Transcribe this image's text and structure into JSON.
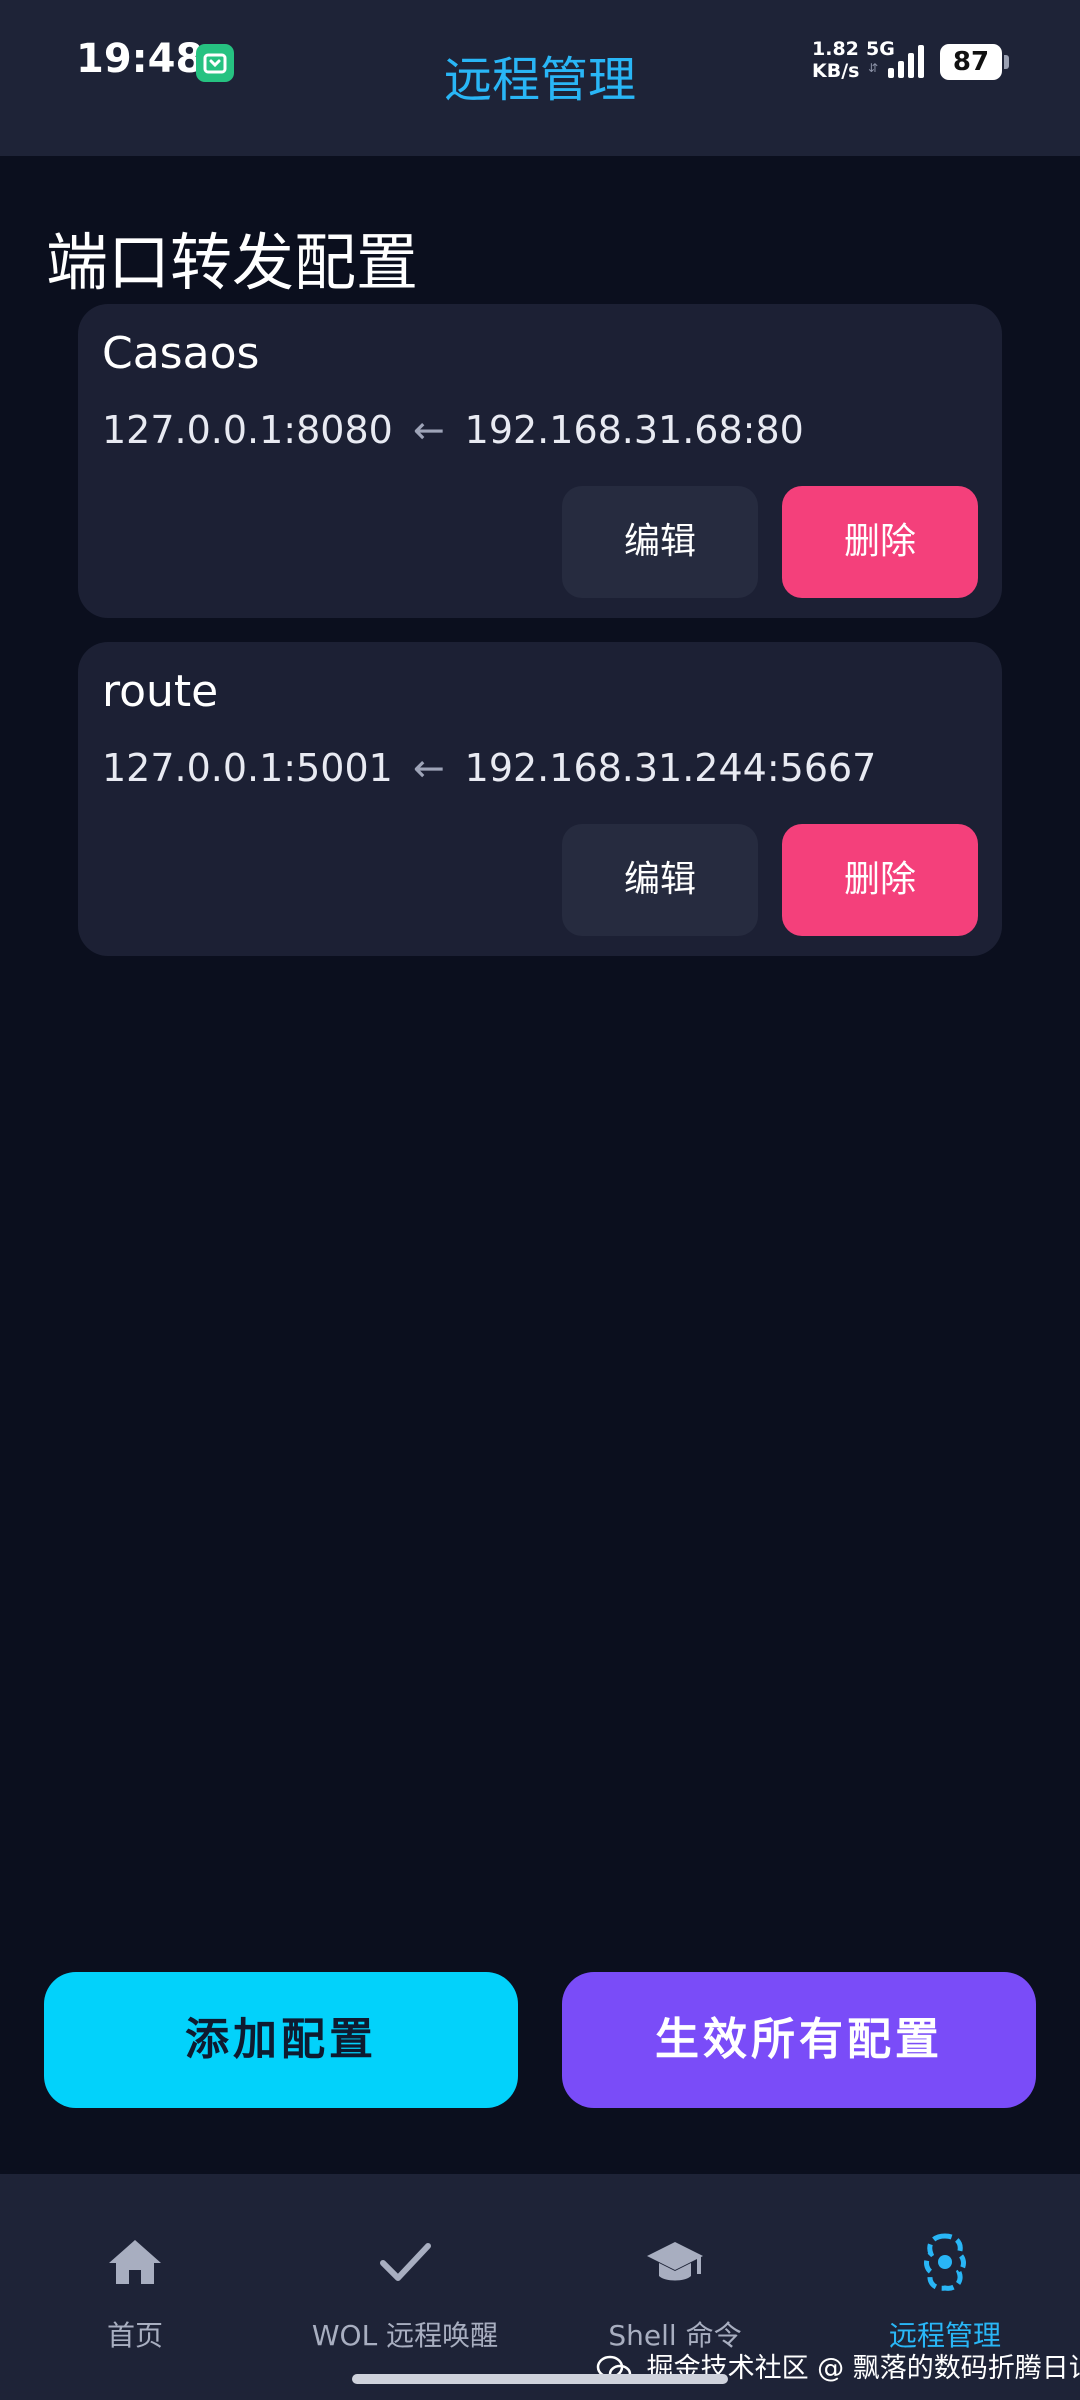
{
  "status_bar": {
    "time": "19:48",
    "net_speed_value": "1.82",
    "net_speed_unit": "KB/s",
    "network_type": "5G",
    "battery": "87"
  },
  "header": {
    "title": "远程管理"
  },
  "section": {
    "title": "端口转发配置"
  },
  "configs": [
    {
      "name": "Casaos",
      "local": "127.0.0.1:8080",
      "arrow": "←",
      "remote": "192.168.31.68:80",
      "edit_label": "编辑",
      "delete_label": "删除"
    },
    {
      "name": "route",
      "local": "127.0.0.1:5001",
      "arrow": "←",
      "remote": "192.168.31.244:5667",
      "edit_label": "编辑",
      "delete_label": "删除"
    }
  ],
  "actions": {
    "add_label": "添加配置",
    "apply_label": "生效所有配置"
  },
  "bottom_nav": [
    {
      "label": "首页",
      "icon": "home-icon",
      "active": false
    },
    {
      "label": "WOL 远程唤醒",
      "icon": "check-icon",
      "active": false
    },
    {
      "label": "Shell 命令",
      "icon": "graduation-cap-icon",
      "active": false
    },
    {
      "label": "远程管理",
      "icon": "remote-manage-icon",
      "active": true
    }
  ],
  "watermark": {
    "text": "掘金技术社区 @ 飘落的数码折腾日记"
  },
  "colors": {
    "background": "#0b0f1e",
    "bar_background": "#1e2337",
    "card_background": "#1c2034",
    "accent_blue": "#29b6f6",
    "add_button": "#02d2fb",
    "apply_button": "#7a4cf8",
    "delete_button": "#f4407b",
    "edit_button": "#262b3f"
  }
}
